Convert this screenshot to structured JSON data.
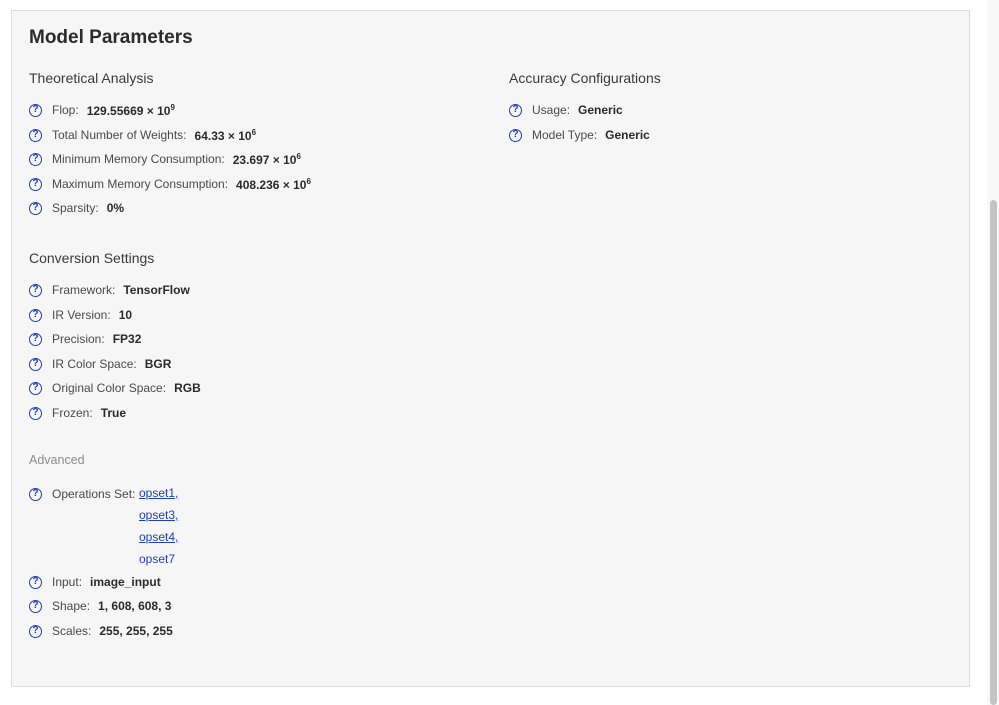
{
  "page": {
    "title": "Model Parameters"
  },
  "theoretical": {
    "title": "Theoretical Analysis",
    "flop": {
      "label": "Flop:",
      "value": "129.55669 × 10",
      "exp": "9"
    },
    "weights": {
      "label": "Total Number of Weights:",
      "value": "64.33 × 10",
      "exp": "6"
    },
    "min_mem": {
      "label": "Minimum Memory Consumption:",
      "value": "23.697 × 10",
      "exp": "6"
    },
    "max_mem": {
      "label": "Maximum Memory Consumption:",
      "value": "408.236 × 10",
      "exp": "6"
    },
    "sparsity": {
      "label": "Sparsity:",
      "value": "0%"
    }
  },
  "accuracy": {
    "title": "Accuracy Configurations",
    "usage": {
      "label": "Usage:",
      "value": "Generic"
    },
    "model_type": {
      "label": "Model Type:",
      "value": "Generic"
    }
  },
  "conversion": {
    "title": "Conversion Settings",
    "framework": {
      "label": "Framework:",
      "value": "TensorFlow"
    },
    "ir_version": {
      "label": "IR Version:",
      "value": "10"
    },
    "precision": {
      "label": "Precision:",
      "value": "FP32"
    },
    "ir_color": {
      "label": "IR Color Space:",
      "value": "BGR"
    },
    "orig_color": {
      "label": "Original Color Space:",
      "value": "RGB"
    },
    "frozen": {
      "label": "Frozen:",
      "value": "True"
    }
  },
  "advanced": {
    "title": "Advanced",
    "ops": {
      "label": "Operations Set:",
      "links": [
        "opset1,",
        "opset3,",
        "opset4,",
        "opset7"
      ]
    },
    "input": {
      "label": "Input:",
      "value": "image_input"
    },
    "shape": {
      "label": "Shape:",
      "value": "1, 608, 608, 3"
    },
    "scales": {
      "label": "Scales:",
      "value": "255, 255, 255"
    }
  },
  "icons": {
    "help": "?"
  },
  "colors": {
    "accent": "#1f3fb6",
    "panel_bg": "#f6f6f6"
  }
}
